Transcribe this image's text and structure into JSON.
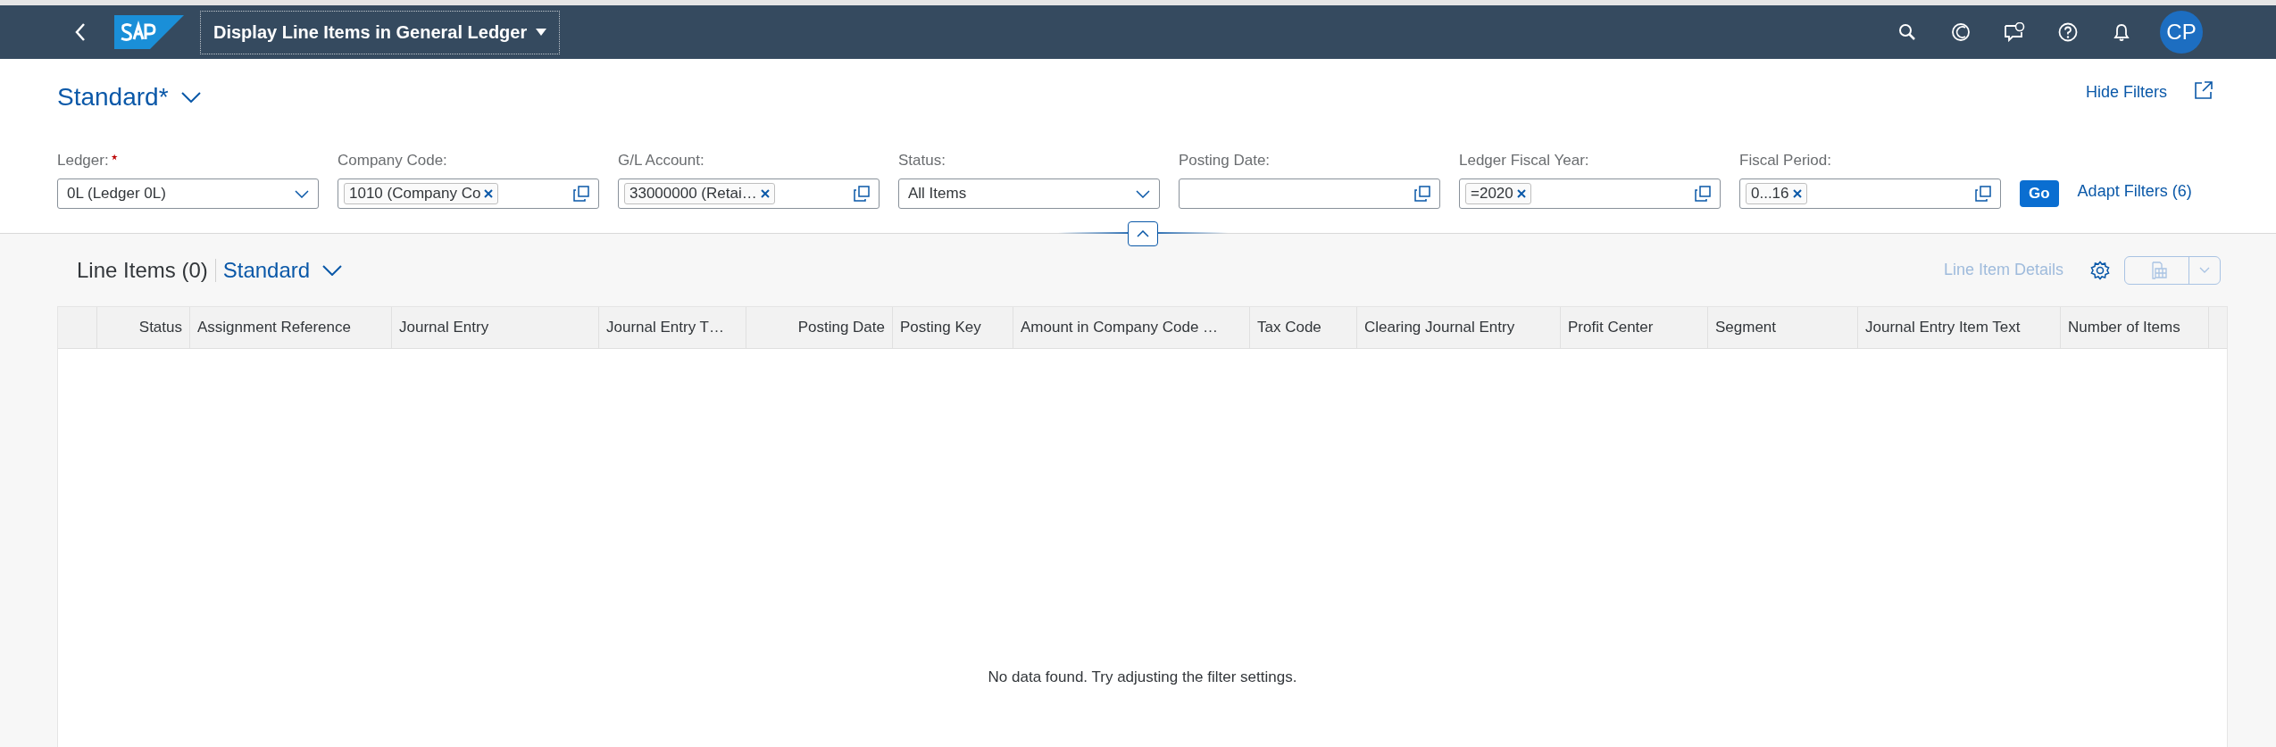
{
  "shell_bar": {
    "title": "Display Line Items in General Ledger",
    "avatar": "CP"
  },
  "variant": {
    "title": "Standard*"
  },
  "filter_actions": {
    "hide_filters": "Hide Filters"
  },
  "filters": [
    {
      "label": "Ledger:",
      "required": true,
      "kind": "select",
      "value": "0L (Ledger 0L)"
    },
    {
      "label": "Company Code:",
      "required": false,
      "kind": "multi-input",
      "tokens": [
        "1010 (Company Co"
      ]
    },
    {
      "label": "G/L Account:",
      "required": false,
      "kind": "multi-input",
      "tokens": [
        "33000000 (Retai…"
      ]
    },
    {
      "label": "Status:",
      "required": false,
      "kind": "select",
      "value": "All Items"
    },
    {
      "label": "Posting Date:",
      "required": false,
      "kind": "multi-input"
    },
    {
      "label": "Ledger Fiscal Year:",
      "required": false,
      "kind": "multi-input",
      "tokens": [
        "=2020"
      ]
    },
    {
      "label": "Fiscal Period:",
      "required": false,
      "kind": "multi-input",
      "tokens": [
        "0...16"
      ]
    }
  ],
  "go_button": "Go",
  "adapt_filters": "Adapt Filters (6)",
  "table": {
    "title": "Line Items (0)",
    "variant": "Standard",
    "toolbar": {
      "details_button": {
        "label": "Line Item Details",
        "disabled": true
      }
    },
    "columns": [
      {
        "label": "Status"
      },
      {
        "label": "Assignment Reference"
      },
      {
        "label": "Journal Entry"
      },
      {
        "label": "Journal Entry T…"
      },
      {
        "label": "Posting Date"
      },
      {
        "label": "Posting Key"
      },
      {
        "label": "Amount in Company Code …"
      },
      {
        "label": "Tax Code"
      },
      {
        "label": "Clearing Journal Entry"
      },
      {
        "label": "Profit Center"
      },
      {
        "label": "Segment"
      },
      {
        "label": "Journal Entry Item Text"
      },
      {
        "label": "Number of Items"
      }
    ],
    "no_data": "No data found. Try adjusting the filter settings."
  }
}
